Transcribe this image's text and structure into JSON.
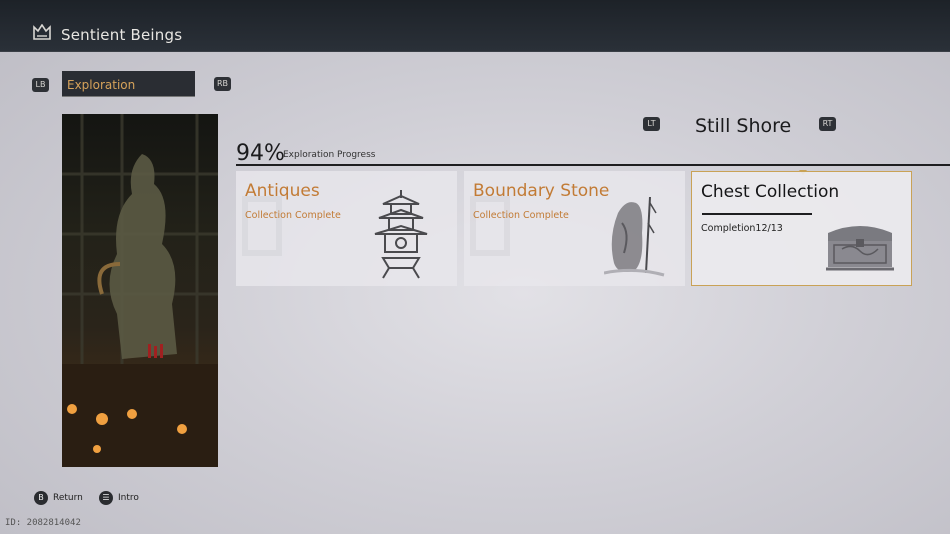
{
  "header": {
    "title": "Sentient Beings",
    "icon": "crown-banner-icon"
  },
  "tabs": {
    "prev_button": "LB",
    "next_button": "RB",
    "active_label": "Exploration"
  },
  "region": {
    "prev_button": "LT",
    "next_button": "RT",
    "name": "Still Shore"
  },
  "progress": {
    "percent_text": "94%",
    "label": "Exploration Progress",
    "value": 94
  },
  "cards": [
    {
      "name": "Antiques",
      "status": "Collection Complete",
      "icon": "pagoda-lantern-icon",
      "selected": false
    },
    {
      "name": "Boundary Stone",
      "status": "Collection Complete",
      "icon": "boundary-stone-icon",
      "selected": false
    },
    {
      "name": "Chest Collection",
      "status": "Completion12/13",
      "icon": "treasure-chest-icon",
      "selected": true
    }
  ],
  "footer": {
    "return_button": "B",
    "return_label": "Return",
    "intro_button": "☰",
    "intro_label": "Intro",
    "id_text": "ID: 2082814042"
  },
  "colors": {
    "accent_orange": "#c27b35",
    "selection_gold": "#c9a256",
    "topbar": "#1d2228"
  }
}
